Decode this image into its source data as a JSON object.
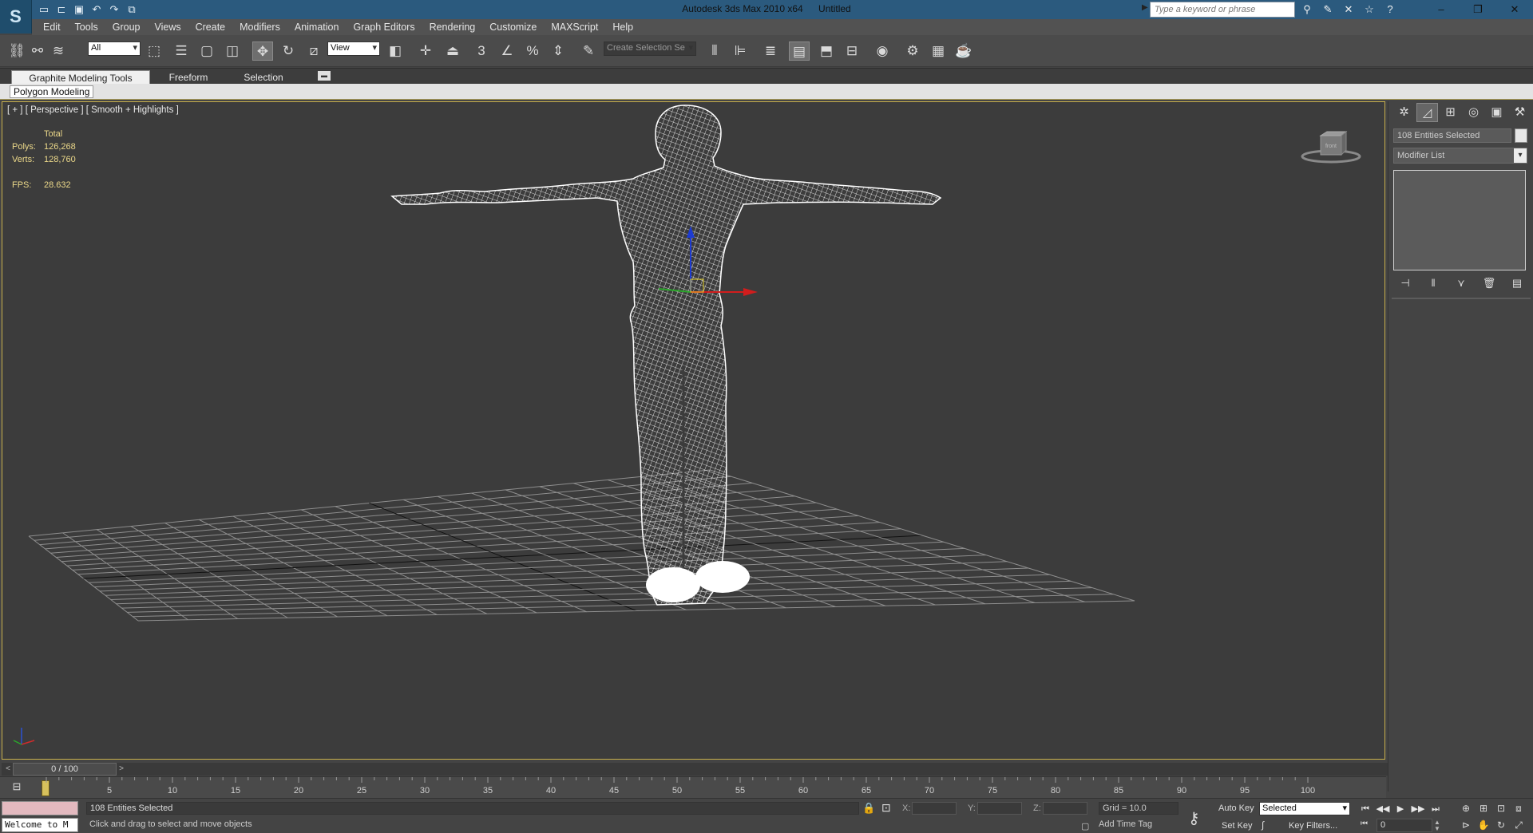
{
  "title_bar": {
    "app_name": "Autodesk 3ds Max  2010 x64",
    "document": "Untitled",
    "search_placeholder": "Type a keyword or phrase",
    "logo_glyph": "S"
  },
  "quick_access": [
    "new-icon",
    "open-icon",
    "save-icon",
    "undo-icon",
    "redo-icon",
    "project-icon"
  ],
  "menu": [
    "Edit",
    "Tools",
    "Group",
    "Views",
    "Create",
    "Modifiers",
    "Animation",
    "Graph Editors",
    "Rendering",
    "Customize",
    "MAXScript",
    "Help"
  ],
  "toolbar": {
    "selection_filter": "All",
    "ref_coord": "View",
    "snap_label": "3",
    "named_selection": "Create Selection Se"
  },
  "ribbon": {
    "tabs": [
      "Graphite Modeling Tools",
      "Freeform",
      "Selection"
    ],
    "panel": "Polygon Modeling"
  },
  "viewport": {
    "label": "[ + ] [ Perspective ] [ Smooth + Highlights ]",
    "stats": {
      "header": "Total",
      "polys_label": "Polys:",
      "polys_value": "126,268",
      "verts_label": "Verts:",
      "verts_value": "128,760",
      "fps_label": "FPS:",
      "fps_value": "28.632"
    },
    "viewcube_label": "front"
  },
  "command_panel": {
    "selection_name": "108 Entities Selected",
    "modifier_list": "Modifier List"
  },
  "timeline": {
    "slider_label": "0 / 100",
    "ticks": [
      "5",
      "10",
      "15",
      "20",
      "25",
      "30",
      "35",
      "40",
      "45",
      "50",
      "55",
      "60",
      "65",
      "70",
      "75",
      "80",
      "85",
      "90",
      "95",
      "100"
    ]
  },
  "status": {
    "maxscript_text": "Welcome to M",
    "selection_info": "108 Entities Selected",
    "prompt": "Click and drag to select and move objects",
    "x_label": "X:",
    "y_label": "Y:",
    "z_label": "Z:",
    "grid": "Grid = 10.0",
    "add_time_tag": "Add Time Tag",
    "auto_key": "Auto Key",
    "set_key": "Set Key",
    "selected_dropdown": "Selected",
    "key_filters": "Key Filters...",
    "current_frame": "0"
  },
  "colors": {
    "title_bar": "#2b5a7e",
    "viewport_bg": "#3c3c3c",
    "active_border": "#c9b04c",
    "stats_text": "#ecd98a",
    "wireframe": "#ffffff"
  }
}
